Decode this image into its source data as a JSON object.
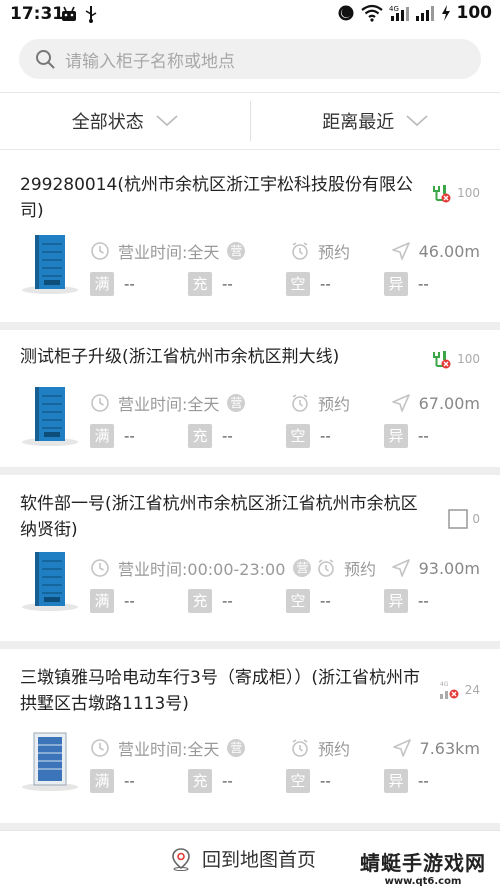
{
  "status_bar": {
    "time": "17:31",
    "battery": "100"
  },
  "search": {
    "placeholder": "请输入柜子名称或地点"
  },
  "filters": {
    "status_label": "全部状态",
    "sort_label": "距离最近"
  },
  "cards": [
    {
      "title": "299280014(杭州市余杭区浙江宇松科技股份有限公司)",
      "status_count": "100",
      "status_icon": "charging-plug-icon",
      "hours": "营业时间:全天",
      "appointment": "预约",
      "distance": "46.00m",
      "counts": [
        {
          "badge": "满",
          "value": "--"
        },
        {
          "badge": "充",
          "value": "--"
        },
        {
          "badge": "空",
          "value": "--"
        },
        {
          "badge": "异",
          "value": "--"
        }
      ]
    },
    {
      "title": "测试柜子升级(浙江省杭州市余杭区荆大线)",
      "status_count": "100",
      "status_icon": "charging-plug-icon",
      "hours": "营业时间:全天",
      "appointment": "预约",
      "distance": "67.00m",
      "counts": [
        {
          "badge": "满",
          "value": "--"
        },
        {
          "badge": "充",
          "value": "--"
        },
        {
          "badge": "空",
          "value": "--"
        },
        {
          "badge": "异",
          "value": "--"
        }
      ]
    },
    {
      "title": "软件部一号(浙江省杭州市余杭区浙江省杭州市余杭区纳贤街)",
      "status_count": "0",
      "status_icon": "checkbox-icon",
      "hours": "营业时间:00:00-23:00",
      "appointment": "预约",
      "distance": "93.00m",
      "counts": [
        {
          "badge": "满",
          "value": "--"
        },
        {
          "badge": "充",
          "value": "--"
        },
        {
          "badge": "空",
          "value": "--"
        },
        {
          "badge": "异",
          "value": "--"
        }
      ]
    },
    {
      "title": "三墩镇雅马哈电动车行3号（寄成柜））(浙江省杭州市拱墅区古墩路1113号)",
      "status_count": "24",
      "status_icon": "signal-error-icon",
      "hours": "营业时间:全天",
      "appointment": "预约",
      "distance": "7.63km",
      "counts": [
        {
          "badge": "满",
          "value": "--"
        },
        {
          "badge": "充",
          "value": "--"
        },
        {
          "badge": "空",
          "value": "--"
        },
        {
          "badge": "异",
          "value": "--"
        }
      ]
    }
  ],
  "ying_badge": "营",
  "bottom": {
    "back_to_map": "回到地图首页"
  },
  "watermark": {
    "main": "蜻蜓手游戏网",
    "sub": "www.qt6.com"
  },
  "colors": {
    "locker_blue": "#1f7fc2",
    "plug_green": "#3aa648",
    "error_red": "#e53935"
  }
}
